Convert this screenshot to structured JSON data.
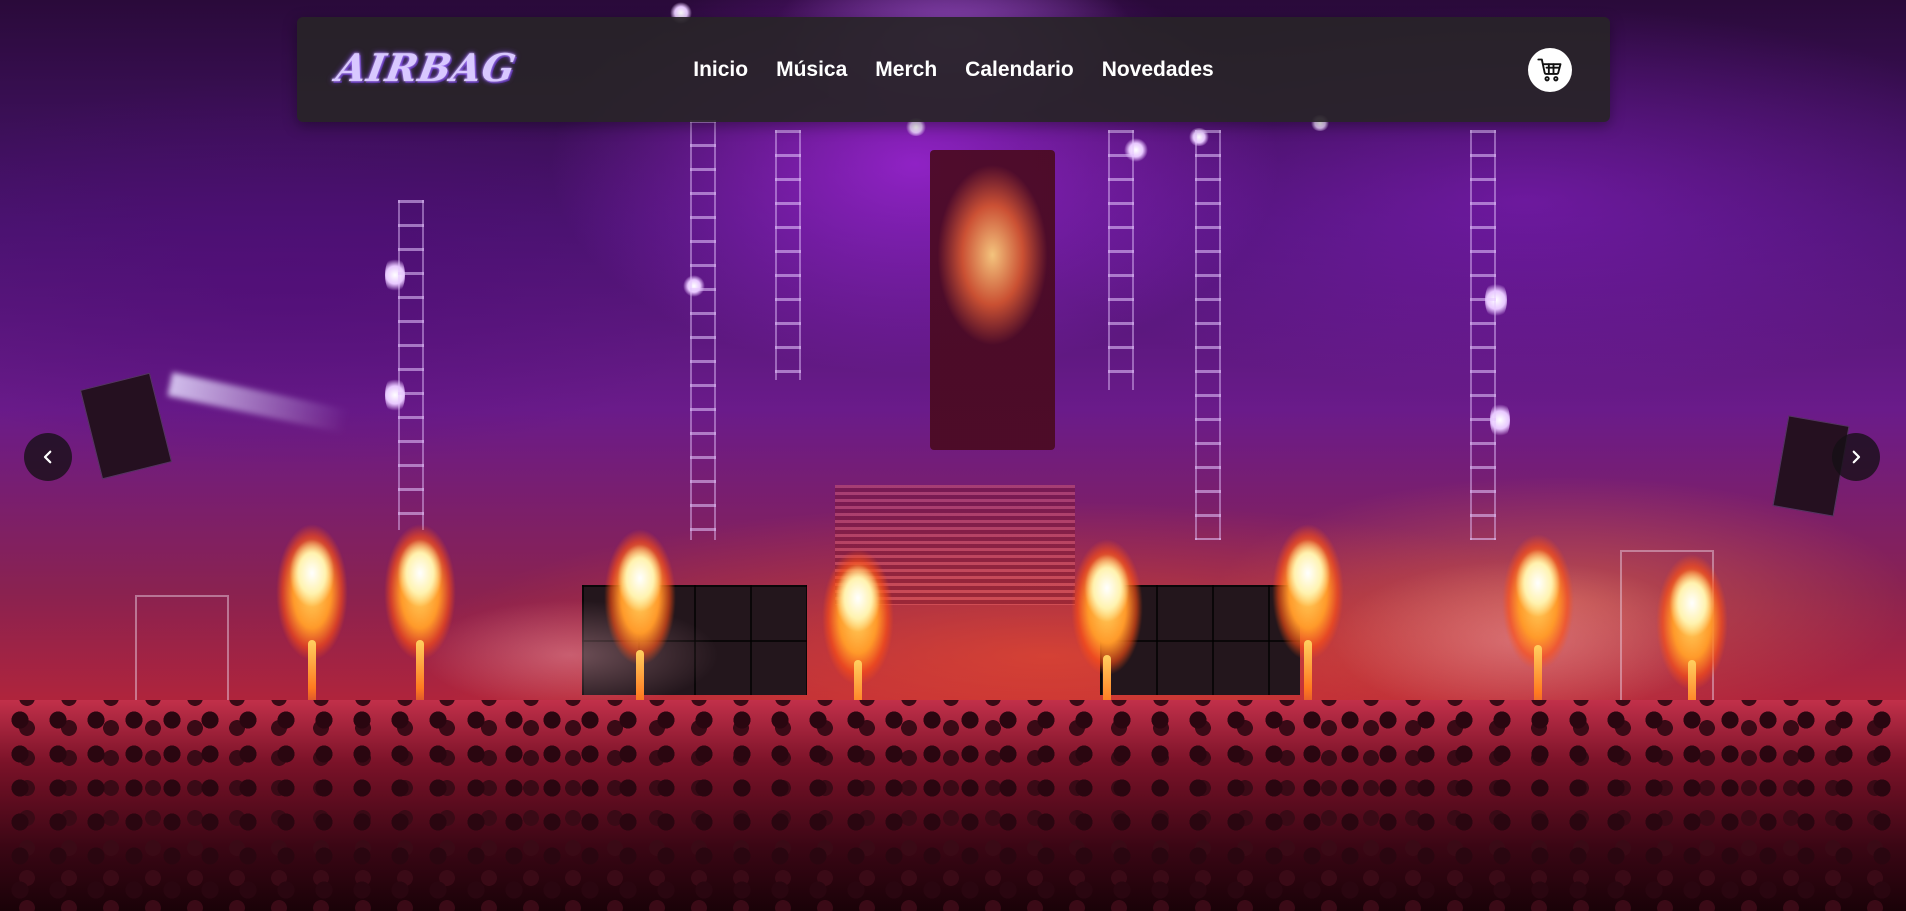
{
  "brand": {
    "logo_text": "AIRBAG",
    "logo_color": "#d8c8ff"
  },
  "nav": {
    "items": [
      {
        "label": "Inicio"
      },
      {
        "label": "Música"
      },
      {
        "label": "Merch"
      },
      {
        "label": "Calendario"
      },
      {
        "label": "Novedades"
      }
    ],
    "background": "#282428"
  },
  "cart": {
    "icon": "shopping-cart-icon"
  },
  "carousel": {
    "prev_icon": "chevron-left-icon",
    "next_icon": "chevron-right-icon",
    "slide_image": "concert-stage-with-pyrotechnics"
  },
  "colors": {
    "stage_purple": "#6a1b8a",
    "flame_orange": "#ff9a2a",
    "crowd_red": "#c2304a"
  }
}
